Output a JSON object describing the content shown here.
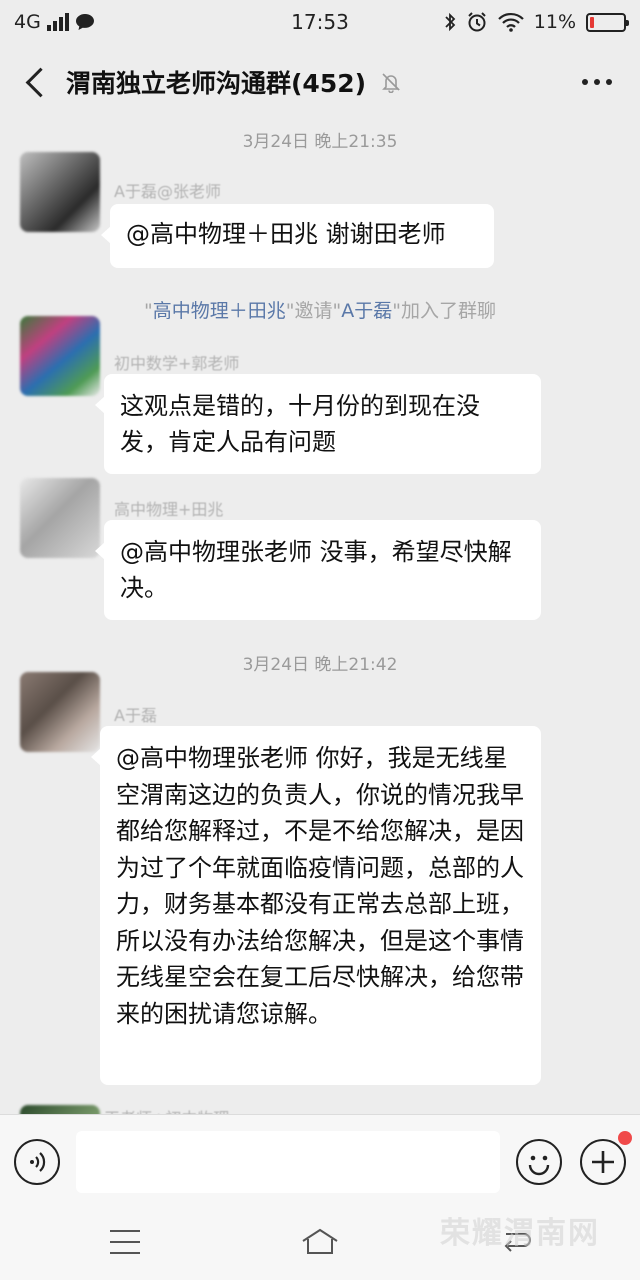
{
  "status_bar": {
    "network": "4G",
    "time": "17:53",
    "battery_percent": "11%",
    "battery_level": 0.11
  },
  "header": {
    "title": "渭南独立老师沟通群(452)"
  },
  "messages": {
    "t1": "3月24日 晚上21:35",
    "m1_sender": "A于磊@张老师",
    "m1_text": "@高中物理＋田兆  谢谢田老师",
    "sys1": {
      "a": "\"",
      "b": "高中物理＋田兆",
      "c": "\"邀请\"",
      "d": "A于磊",
      "e": "\"加入了群聊"
    },
    "m2_sender": "初中数学+郭老师",
    "m2_text": "这观点是错的，十月份的到现在没发，肯定人品有问题",
    "m3_sender": "高中物理+田兆",
    "m3_text": "@高中物理张老师  没事，希望尽快解决。",
    "t2": "3月24日 晚上21:42",
    "m4_sender": "A于磊",
    "m4_text": "@高中物理张老师  你好，我是无线星空渭南这边的负责人，你说的情况我早都给您解释过，不是不给您解决，是因为过了个年就面临疫情问题，总部的人力，财务基本都没有正常去总部上班，所以没有办法给您解决，但是这个事情无线星空会在复工后尽快解决，给您带来的困扰请您谅解。",
    "m5_sender": "王老师+初中物理"
  },
  "input": {
    "value": ""
  },
  "watermark": "荣耀渭南网",
  "colors": {
    "accent_red": "#f04a4a",
    "battery_red": "#e53935",
    "link_blue": "#5a78a8"
  }
}
